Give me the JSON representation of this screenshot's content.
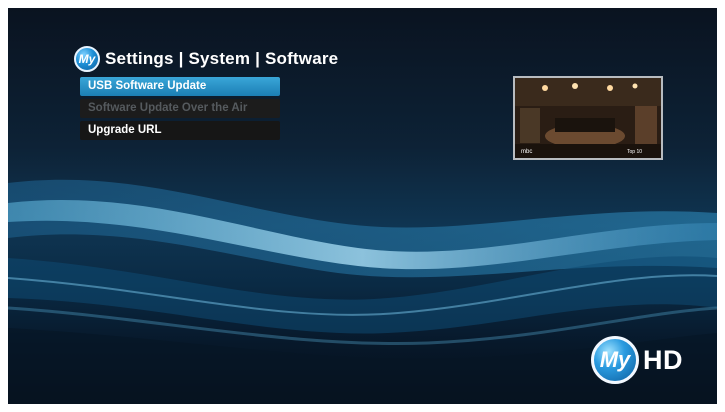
{
  "header": {
    "badge": "My",
    "title": "Settings | System | Software"
  },
  "menu": {
    "items": [
      {
        "label": "USB Software Update",
        "state": "selected"
      },
      {
        "label": "Software Update Over the Air",
        "state": "disabled"
      },
      {
        "label": "Upgrade URL",
        "state": "normal"
      }
    ]
  },
  "preview": {
    "channel_logo": "mbc",
    "overlay_text": "Top 10"
  },
  "brand": {
    "logo_my": "My",
    "logo_hd": "HD"
  },
  "colors": {
    "selected": "#2a93c8",
    "disabled_text": "#555a5e",
    "accent": "#1d8fd6"
  }
}
